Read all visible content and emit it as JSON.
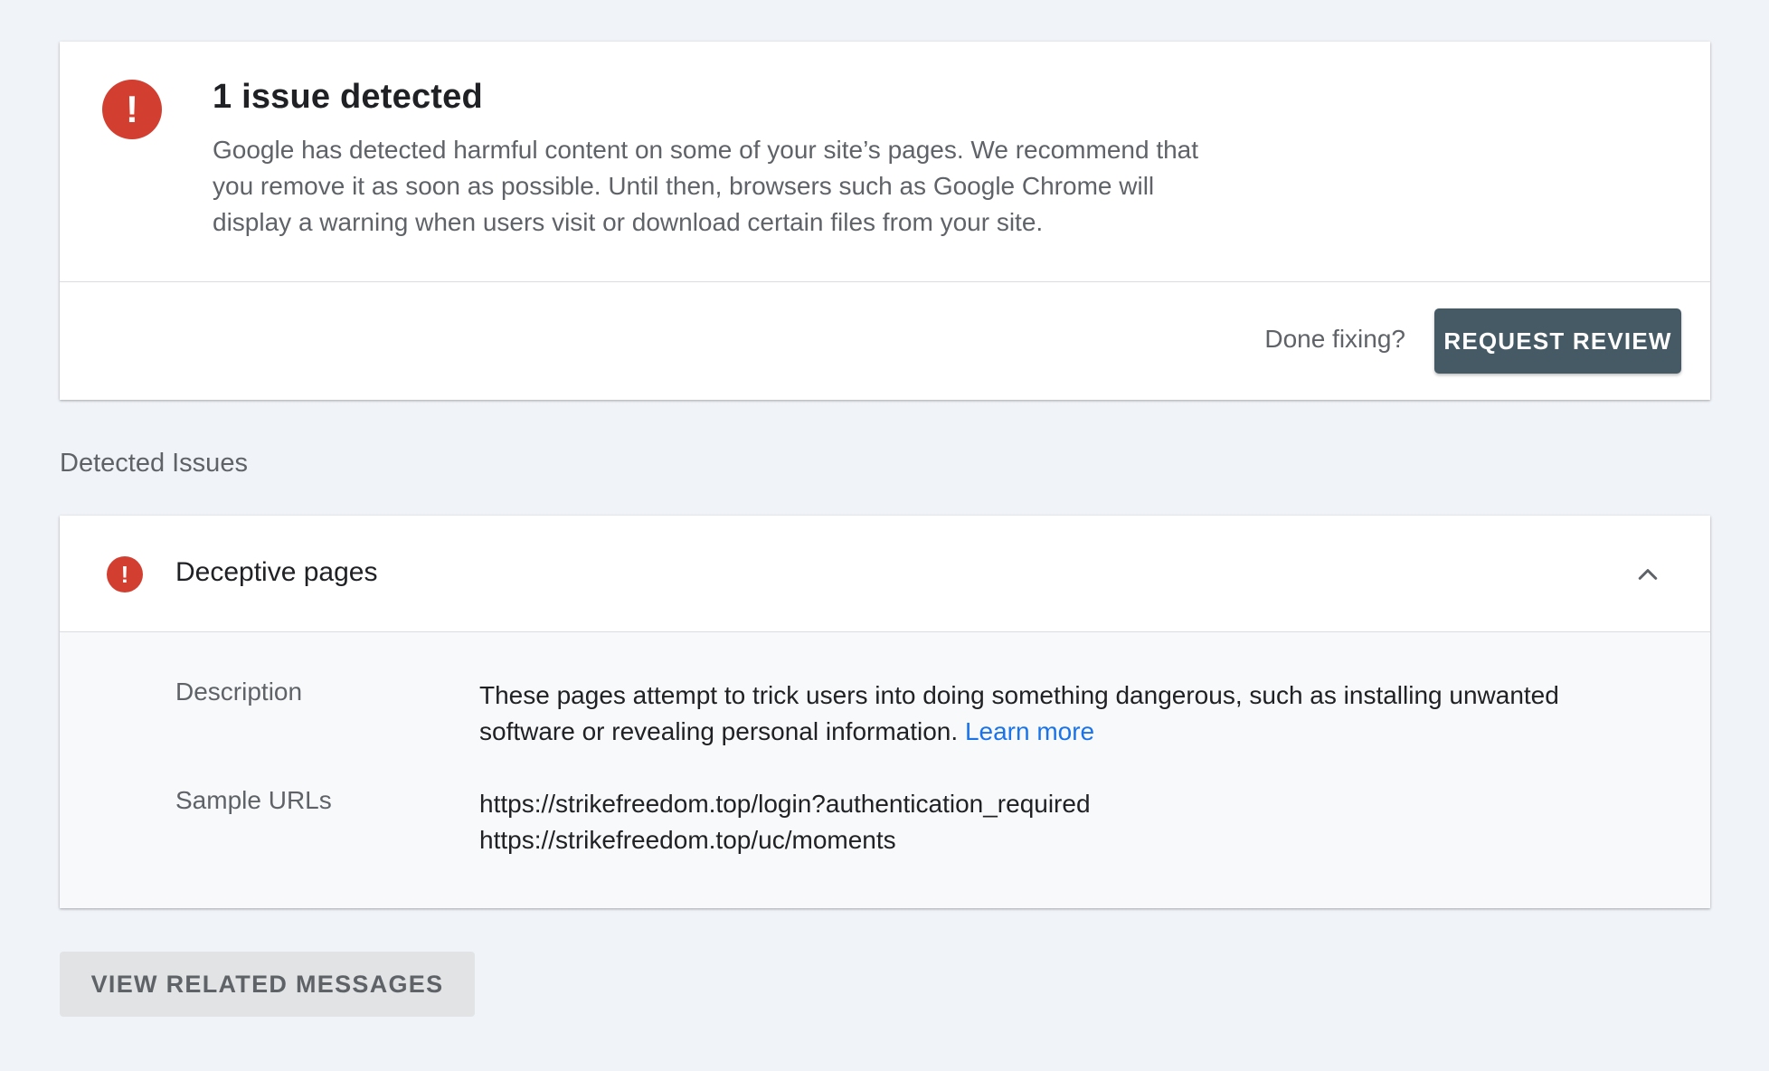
{
  "summary": {
    "alert_icon": "exclamation-circle-icon",
    "alert_glyph": "!",
    "title": "1 issue detected",
    "description": "Google has detected harmful content on some of your site’s pages. We recommend that you remove it as soon as possible. Until then, browsers such as Google Chrome will display a warning when users visit or download certain files from your site.",
    "done_label": "Done fixing?",
    "request_review_label": "REQUEST REVIEW"
  },
  "detected_issues": {
    "section_label": "Detected Issues",
    "issues": [
      {
        "icon": "exclamation-circle-icon",
        "icon_glyph": "!",
        "title": "Deceptive pages",
        "expanded": true,
        "toggle_icon": "chevron-up-icon",
        "description_label": "Description",
        "description": "These pages attempt to trick users into doing something dangerous, such as installing unwanted software or revealing personal information.",
        "learn_more": "Learn more",
        "sample_urls_label": "Sample URLs",
        "sample_urls": [
          "https://strikefreedom.top/login?authentication_required",
          "https://strikefreedom.top/uc/moments"
        ]
      }
    ]
  },
  "actions": {
    "view_related_messages_label": "VIEW RELATED MESSAGES"
  },
  "colors": {
    "page_background": "#f0f3f8",
    "alert_red": "#d23f31",
    "primary_button": "#455a64",
    "link_blue": "#1a73e8",
    "secondary_button": "#e1e3e5"
  }
}
